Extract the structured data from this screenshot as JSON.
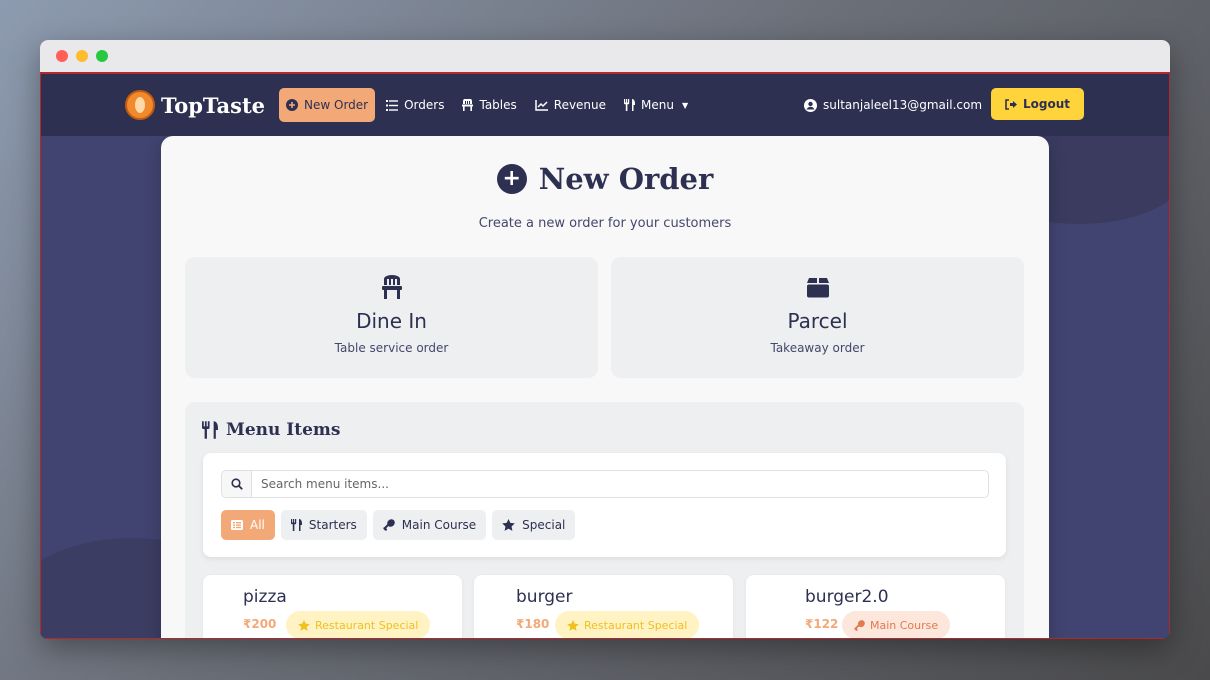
{
  "window": {
    "controls": [
      "close",
      "minimize",
      "maximize"
    ]
  },
  "navbar": {
    "brand": "TopTaste",
    "items": [
      {
        "label": "New Order",
        "icon": "plus-circle-icon",
        "active": true
      },
      {
        "label": "Orders",
        "icon": "list-icon",
        "active": false
      },
      {
        "label": "Tables",
        "icon": "chair-icon",
        "active": false
      },
      {
        "label": "Revenue",
        "icon": "line-chart-icon",
        "active": false
      },
      {
        "label": "Menu",
        "icon": "utensils-icon",
        "active": false,
        "dropdown": true
      }
    ],
    "user_email": "sultanjaleel13@gmail.com",
    "logout_label": "Logout"
  },
  "page": {
    "title": "New Order",
    "subtitle": "Create a new order for your customers"
  },
  "order_types": [
    {
      "title": "Dine In",
      "subtitle": "Table service order",
      "icon": "chair-icon"
    },
    {
      "title": "Parcel",
      "subtitle": "Takeaway order",
      "icon": "box-icon"
    }
  ],
  "menu_section": {
    "heading": "Menu Items",
    "search_placeholder": "Search menu items...",
    "filters": [
      {
        "label": "All",
        "icon": "list-icon",
        "active": true
      },
      {
        "label": "Starters",
        "icon": "utensils-icon",
        "active": false
      },
      {
        "label": "Main Course",
        "icon": "drumstick-icon",
        "active": false
      },
      {
        "label": "Special",
        "icon": "star-icon",
        "active": false
      }
    ],
    "items": [
      {
        "name": "pizza",
        "price": "₹200",
        "badge": "Restaurant Special",
        "badge_type": "special"
      },
      {
        "name": "burger",
        "price": "₹180",
        "badge": "Restaurant Special",
        "badge_type": "special"
      },
      {
        "name": "burger2.0",
        "price": "₹122",
        "badge": "Main Course",
        "badge_type": "main"
      }
    ]
  },
  "colors": {
    "navy": "#2e3052",
    "accent_orange": "#f3a977",
    "logout_yellow": "#ffd43b",
    "special_badge": "#f0c020",
    "main_badge": "#e07b50"
  }
}
